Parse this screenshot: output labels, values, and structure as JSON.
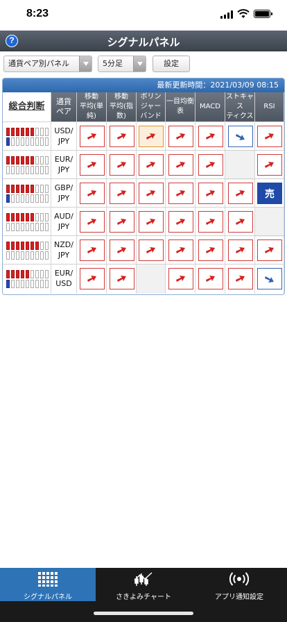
{
  "status_bar": {
    "time": "8:23"
  },
  "header": {
    "title": "シグナルパネル",
    "help_icon": "question-circle-icon"
  },
  "controls": {
    "mode_select": "通貨ペア別パネル",
    "timeframe_select": "5分足",
    "settings_button": "設定"
  },
  "panel": {
    "last_updated_label": "最新更新時間：2021/03/09 08:15",
    "columns": [
      {
        "l1": "総合判断",
        "l2": ""
      },
      {
        "l1": "通貨",
        "l2": "ペア"
      },
      {
        "l1": "移動",
        "l2": "平均(単",
        "l3": "純)"
      },
      {
        "l1": "移動",
        "l2": "平均(指",
        "l3": "数)"
      },
      {
        "l1": "ボリン",
        "l2": "ジャー",
        "l3": "バンド"
      },
      {
        "l1": "一目均衡",
        "l2": "表"
      },
      {
        "l1": "MACD"
      },
      {
        "l1": "ストキャス",
        "l2": "ティクス"
      },
      {
        "l1": "RSI"
      }
    ],
    "rows": [
      {
        "pair_top": "USD/",
        "pair_bottom": "JPY",
        "gauge_red": 6,
        "gauge_blue": 1,
        "signals": [
          "up",
          "up",
          "up-hl",
          "up",
          "up",
          "down",
          "up"
        ]
      },
      {
        "pair_top": "EUR/",
        "pair_bottom": "JPY",
        "gauge_red": 6,
        "gauge_blue": 0,
        "signals": [
          "up",
          "up",
          "up",
          "up",
          "up",
          "empty",
          "up"
        ]
      },
      {
        "pair_top": "GBP/",
        "pair_bottom": "JPY",
        "gauge_red": 6,
        "gauge_blue": 1,
        "signals": [
          "up",
          "up",
          "up",
          "up",
          "up",
          "up",
          "sell"
        ]
      },
      {
        "pair_top": "AUD/",
        "pair_bottom": "JPY",
        "gauge_red": 6,
        "gauge_blue": 0,
        "signals": [
          "up",
          "up",
          "up",
          "up",
          "up",
          "up",
          "empty"
        ]
      },
      {
        "pair_top": "NZD/",
        "pair_bottom": "JPY",
        "gauge_red": 7,
        "gauge_blue": 0,
        "signals": [
          "up",
          "up",
          "up",
          "up",
          "up",
          "up",
          "up"
        ]
      },
      {
        "pair_top": "EUR/",
        "pair_bottom": "USD",
        "gauge_red": 5,
        "gauge_blue": 1,
        "signals": [
          "up",
          "up",
          "empty",
          "up",
          "up",
          "up",
          "down"
        ]
      }
    ],
    "sell_label": "売"
  },
  "tabs": [
    {
      "label": "シグナルパネル",
      "icon": "grid-panel-icon",
      "active": true
    },
    {
      "label": "さきよみチャート",
      "icon": "chart-candles-icon",
      "active": false
    },
    {
      "label": "アプリ通知設定",
      "icon": "broadcast-icon",
      "active": false
    }
  ],
  "colors": {
    "signal_red": "#d62020",
    "signal_blue": "#2e63b6",
    "header_blue": "#2e68ad",
    "tab_active": "#2e73b6"
  }
}
